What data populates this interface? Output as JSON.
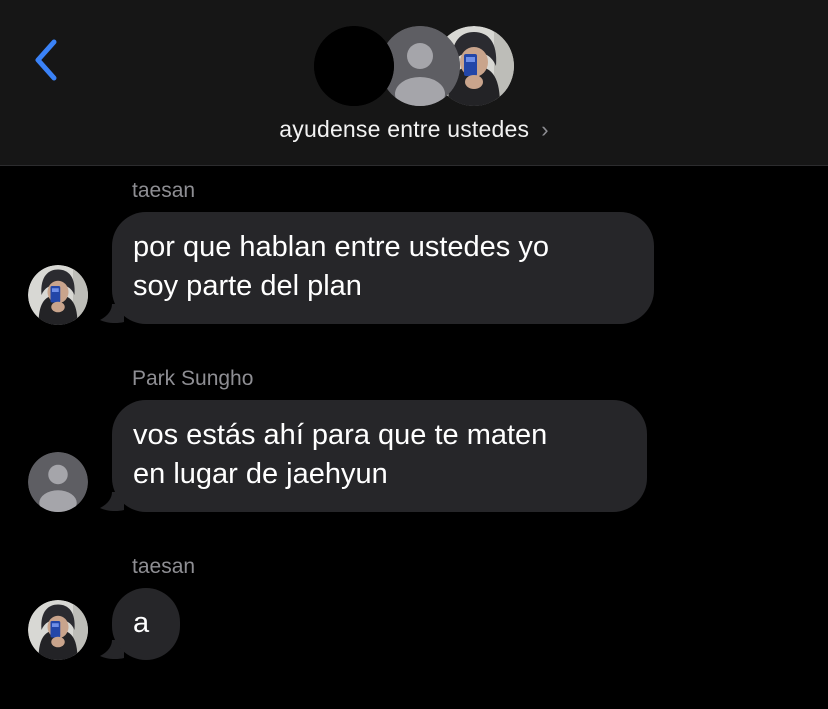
{
  "header": {
    "group_title": "ayudense entre ustedes",
    "chevron": "›",
    "back_icon": "chevron-left-icon",
    "accent_color": "#3a82f7",
    "avatars": [
      "black-avatar",
      "default-person-avatar",
      "photo-avatar"
    ]
  },
  "messages": [
    {
      "sender": "taesan",
      "lines": [
        "por que hablan entre ustedes yo",
        "soy parte del plan"
      ],
      "avatar": "photo-avatar"
    },
    {
      "sender": "Park Sungho",
      "lines": [
        "vos estás ahí para que te maten",
        "en lugar de jaehyun"
      ],
      "avatar": "default-person-avatar"
    },
    {
      "sender": "taesan",
      "lines": [
        "a"
      ],
      "avatar": "photo-avatar"
    }
  ],
  "colors": {
    "background": "#000000",
    "header_bg": "#161616",
    "bubble_bg": "#262629",
    "sender_text": "#8e8e93"
  }
}
